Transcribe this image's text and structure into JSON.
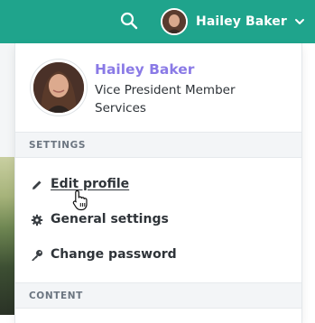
{
  "topbar": {
    "user_name": "Hailey Baker",
    "search_icon": "search-icon",
    "chevron_icon": "chevron-down-icon",
    "bg_color": "#1fa48c"
  },
  "profile": {
    "name": "Hailey Baker",
    "title": "Vice President Member Services",
    "name_color": "#8a7ae6"
  },
  "sections": {
    "settings_label": "SETTINGS",
    "content_label": "CONTENT"
  },
  "menu": {
    "edit_profile": {
      "label": "Edit profile",
      "icon": "pencil-icon"
    },
    "general_settings": {
      "label": "General settings",
      "icon": "gear-icon"
    },
    "change_password": {
      "label": "Change password",
      "icon": "key-icon"
    }
  }
}
